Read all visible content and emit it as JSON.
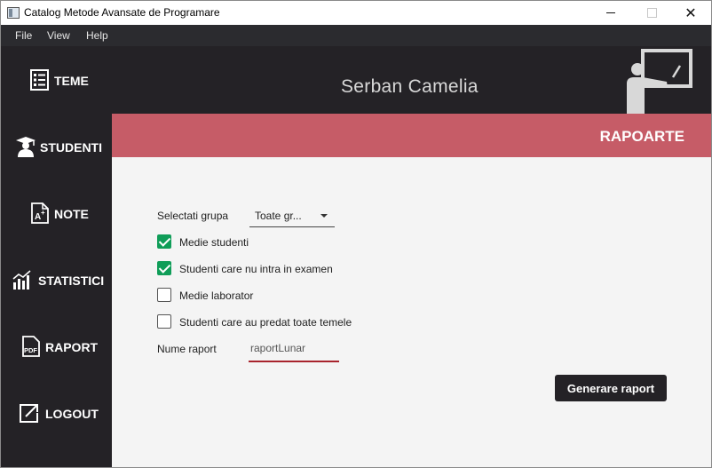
{
  "window": {
    "title": "Catalog Metode Avansate de Programare"
  },
  "menu": {
    "items": [
      "File",
      "View",
      "Help"
    ]
  },
  "sidebar": {
    "items": [
      {
        "label": "TEME",
        "icon": "list-icon"
      },
      {
        "label": "STUDENTI",
        "icon": "student-icon"
      },
      {
        "label": "NOTE",
        "icon": "grade-document-icon"
      },
      {
        "label": "STATISTICI",
        "icon": "bar-chart-icon"
      },
      {
        "label": "RAPORT",
        "icon": "pdf-icon"
      },
      {
        "label": "LOGOUT",
        "icon": "logout-icon"
      }
    ]
  },
  "header": {
    "user_name": "Serban Camelia",
    "banner_title": "RAPOARTE"
  },
  "form": {
    "group_label": "Selectati grupa",
    "group_value": "Toate gr...",
    "checkboxes": [
      {
        "label": "Medie studenti",
        "checked": true
      },
      {
        "label": "Studenti care nu intra in examen",
        "checked": true
      },
      {
        "label": "Medie laborator",
        "checked": false
      },
      {
        "label": "Studenti care au predat toate temele",
        "checked": false
      }
    ],
    "report_name_label": "Nume raport",
    "report_name_value": "raportLunar",
    "generate_label": "Generare raport"
  },
  "colors": {
    "sidebar": "#242226",
    "banner": "#c65c67",
    "checkbox_on": "#0f9d58",
    "input_underline": "#a8242d"
  }
}
